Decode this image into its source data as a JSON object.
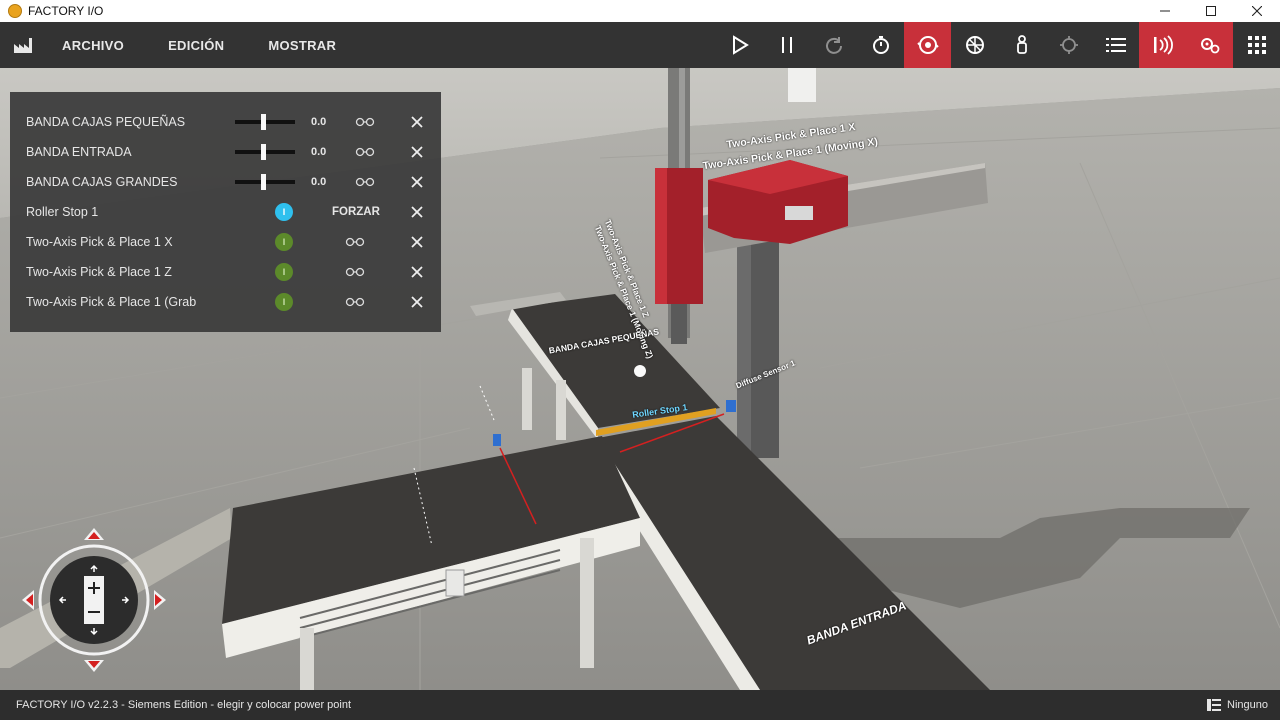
{
  "window": {
    "title": "FACTORY I/O"
  },
  "menu": {
    "items": [
      "ARCHIVO",
      "EDICIÓN",
      "MOSTRAR"
    ]
  },
  "toolbar": {
    "icons": [
      "play-icon",
      "pause-icon",
      "reset-icon",
      "stopwatch-icon",
      "camera-orbit-icon",
      "fly-camera-icon",
      "first-person-icon",
      "target-icon",
      "list-icon",
      "sensors-icon",
      "drivers-icon",
      "grid-icon"
    ],
    "active_color": "#c8303a"
  },
  "panel": {
    "rows": [
      {
        "label": "BANDA CAJAS PEQUEÑAS",
        "kind": "slider",
        "value": "0.0"
      },
      {
        "label": "BANDA ENTRADA",
        "kind": "slider",
        "value": "0.0"
      },
      {
        "label": "BANDA CAJAS GRANDES",
        "kind": "slider",
        "value": "0.0"
      },
      {
        "label": "Roller Stop 1",
        "kind": "force",
        "badge": "I",
        "action": "FORZAR"
      },
      {
        "label": "Two-Axis Pick & Place 1 X",
        "kind": "indicator",
        "badge": "I"
      },
      {
        "label": "Two-Axis Pick & Place 1 Z",
        "kind": "indicator",
        "badge": "I"
      },
      {
        "label": "Two-Axis Pick & Place 1 (Grab",
        "kind": "indicator",
        "badge": "I"
      }
    ]
  },
  "scene_labels": {
    "pick_place_x": "Two-Axis Pick & Place 1 X",
    "pick_place_moving_x": "Two-Axis Pick & Place 1 (Moving X)",
    "pick_place_z": "Two-Axis Pick & Place 1 Z",
    "pick_place_moving_z": "Two-Axis Pick & Place 1 (Moving Z)",
    "banda_cajas_pequenas": "BANDA CAJAS PEQUEÑAS",
    "roller_stop": "Roller Stop 1",
    "diffuse_sensor": "Diffuse Sensor 1",
    "banda_entrada": "BANDA ENTRADA"
  },
  "statusbar": {
    "left": "FACTORY I/O v2.2.3 - Siemens Edition - elegir y colocar power point",
    "right": "Ninguno"
  }
}
